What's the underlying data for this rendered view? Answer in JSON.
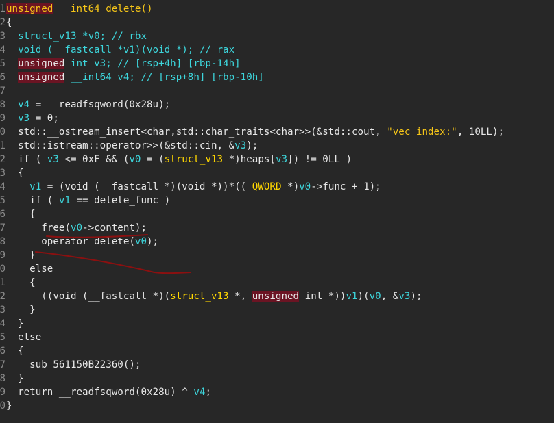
{
  "editor": {
    "lines": [
      {
        "num": "1",
        "tokens": [
          {
            "t": "unsigned",
            "c": "head-kwhl"
          },
          {
            "t": " __int64 delete()",
            "c": "head"
          }
        ]
      },
      {
        "num": "2",
        "tokens": [
          {
            "t": "{",
            "c": "plain"
          }
        ]
      },
      {
        "num": "3",
        "tokens": [
          {
            "t": "  struct_v13 *v0; // rbx",
            "c": "cmt"
          }
        ]
      },
      {
        "num": "4",
        "tokens": [
          {
            "t": "  void (__fastcall *v1)(void *); // rax",
            "c": "cmt"
          }
        ]
      },
      {
        "num": "5",
        "tokens": [
          {
            "t": "  ",
            "c": "plain"
          },
          {
            "t": "unsigned",
            "c": "kwhl"
          },
          {
            "t": " int v3; // [rsp+4h] [rbp-14h]",
            "c": "cmt"
          }
        ]
      },
      {
        "num": "6",
        "tokens": [
          {
            "t": "  ",
            "c": "plain"
          },
          {
            "t": "unsigned",
            "c": "kwhl"
          },
          {
            "t": " __int64 v4; // [rsp+8h] [rbp-10h]",
            "c": "cmt"
          }
        ]
      },
      {
        "num": "7",
        "tokens": [
          {
            "t": "",
            "c": "plain"
          }
        ]
      },
      {
        "num": "8",
        "tokens": [
          {
            "t": "  v4",
            "c": "var"
          },
          {
            "t": " = __readfsqword(0x28u);",
            "c": "plain"
          }
        ]
      },
      {
        "num": "9",
        "tokens": [
          {
            "t": "  v3",
            "c": "var"
          },
          {
            "t": " = 0;",
            "c": "plain"
          }
        ]
      },
      {
        "num": "0",
        "tokens": [
          {
            "t": "  std::__ostream_insert<char,std::char_traits<char>>(&std::cout, ",
            "c": "plain"
          },
          {
            "t": "\"vec index:\"",
            "c": "str"
          },
          {
            "t": ", 10LL);",
            "c": "plain"
          }
        ]
      },
      {
        "num": "1",
        "tokens": [
          {
            "t": "  std::istream::operator>>(&std::cin, &",
            "c": "plain"
          },
          {
            "t": "v3",
            "c": "var"
          },
          {
            "t": ");",
            "c": "plain"
          }
        ]
      },
      {
        "num": "2",
        "tokens": [
          {
            "t": "  if ( ",
            "c": "plain"
          },
          {
            "t": "v3",
            "c": "var"
          },
          {
            "t": " <= 0xF && (",
            "c": "plain"
          },
          {
            "t": "v0",
            "c": "var"
          },
          {
            "t": " = (",
            "c": "plain"
          },
          {
            "t": "struct_v13",
            "c": "type"
          },
          {
            "t": " *)heaps[",
            "c": "plain"
          },
          {
            "t": "v3",
            "c": "var"
          },
          {
            "t": "]) != 0LL )",
            "c": "plain"
          }
        ]
      },
      {
        "num": "3",
        "tokens": [
          {
            "t": "  {",
            "c": "plain"
          }
        ]
      },
      {
        "num": "4",
        "tokens": [
          {
            "t": "    ",
            "c": "plain"
          },
          {
            "t": "v1",
            "c": "var"
          },
          {
            "t": " = (void (__fastcall *)(void *))*((",
            "c": "plain"
          },
          {
            "t": "_QWORD",
            "c": "type"
          },
          {
            "t": " *)",
            "c": "plain"
          },
          {
            "t": "v0",
            "c": "var"
          },
          {
            "t": "->func + 1);",
            "c": "plain"
          }
        ]
      },
      {
        "num": "5",
        "tokens": [
          {
            "t": "    if ( ",
            "c": "plain"
          },
          {
            "t": "v1",
            "c": "var"
          },
          {
            "t": " == delete_func )",
            "c": "plain"
          }
        ]
      },
      {
        "num": "6",
        "tokens": [
          {
            "t": "    {",
            "c": "plain"
          }
        ]
      },
      {
        "num": "7",
        "tokens": [
          {
            "t": "      free(",
            "c": "plain"
          },
          {
            "t": "v0",
            "c": "var"
          },
          {
            "t": "->content);",
            "c": "plain"
          }
        ]
      },
      {
        "num": "8",
        "tokens": [
          {
            "t": "      operator delete(",
            "c": "plain"
          },
          {
            "t": "v0",
            "c": "var"
          },
          {
            "t": ");",
            "c": "plain"
          }
        ]
      },
      {
        "num": "9",
        "tokens": [
          {
            "t": "    }",
            "c": "plain"
          }
        ]
      },
      {
        "num": "0",
        "tokens": [
          {
            "t": "    else",
            "c": "plain"
          }
        ]
      },
      {
        "num": "1",
        "tokens": [
          {
            "t": "    {",
            "c": "plain"
          }
        ]
      },
      {
        "num": "2",
        "tokens": [
          {
            "t": "      ((void (__fastcall *)(",
            "c": "plain"
          },
          {
            "t": "struct_v13",
            "c": "type"
          },
          {
            "t": " *, ",
            "c": "plain"
          },
          {
            "t": "unsigned",
            "c": "kwhl"
          },
          {
            "t": " int *))",
            "c": "plain"
          },
          {
            "t": "v1",
            "c": "var"
          },
          {
            "t": ")(",
            "c": "plain"
          },
          {
            "t": "v0",
            "c": "var"
          },
          {
            "t": ", &",
            "c": "plain"
          },
          {
            "t": "v3",
            "c": "var"
          },
          {
            "t": ");",
            "c": "plain"
          }
        ]
      },
      {
        "num": "3",
        "tokens": [
          {
            "t": "    }",
            "c": "plain"
          }
        ]
      },
      {
        "num": "4",
        "tokens": [
          {
            "t": "  }",
            "c": "plain"
          }
        ]
      },
      {
        "num": "5",
        "tokens": [
          {
            "t": "  else",
            "c": "plain"
          }
        ]
      },
      {
        "num": "6",
        "tokens": [
          {
            "t": "  {",
            "c": "plain"
          }
        ]
      },
      {
        "num": "7",
        "tokens": [
          {
            "t": "    sub_561150B22360();",
            "c": "plain"
          }
        ]
      },
      {
        "num": "8",
        "tokens": [
          {
            "t": "  }",
            "c": "plain"
          }
        ]
      },
      {
        "num": "9",
        "tokens": [
          {
            "t": "  return __readfsqword(0x28u) ^ ",
            "c": "plain"
          },
          {
            "t": "v4",
            "c": "var"
          },
          {
            "t": ";",
            "c": "plain"
          }
        ]
      },
      {
        "num": "0",
        "tokens": [
          {
            "t": "}",
            "c": "plain"
          }
        ]
      }
    ]
  },
  "colors": {
    "background": "#272727",
    "text": "#e6e6e6",
    "variable": "#3dd6dc",
    "string": "#f5c518",
    "keyword_highlight_bg": "#6b1423",
    "annotation_ink": "#8b1010"
  }
}
